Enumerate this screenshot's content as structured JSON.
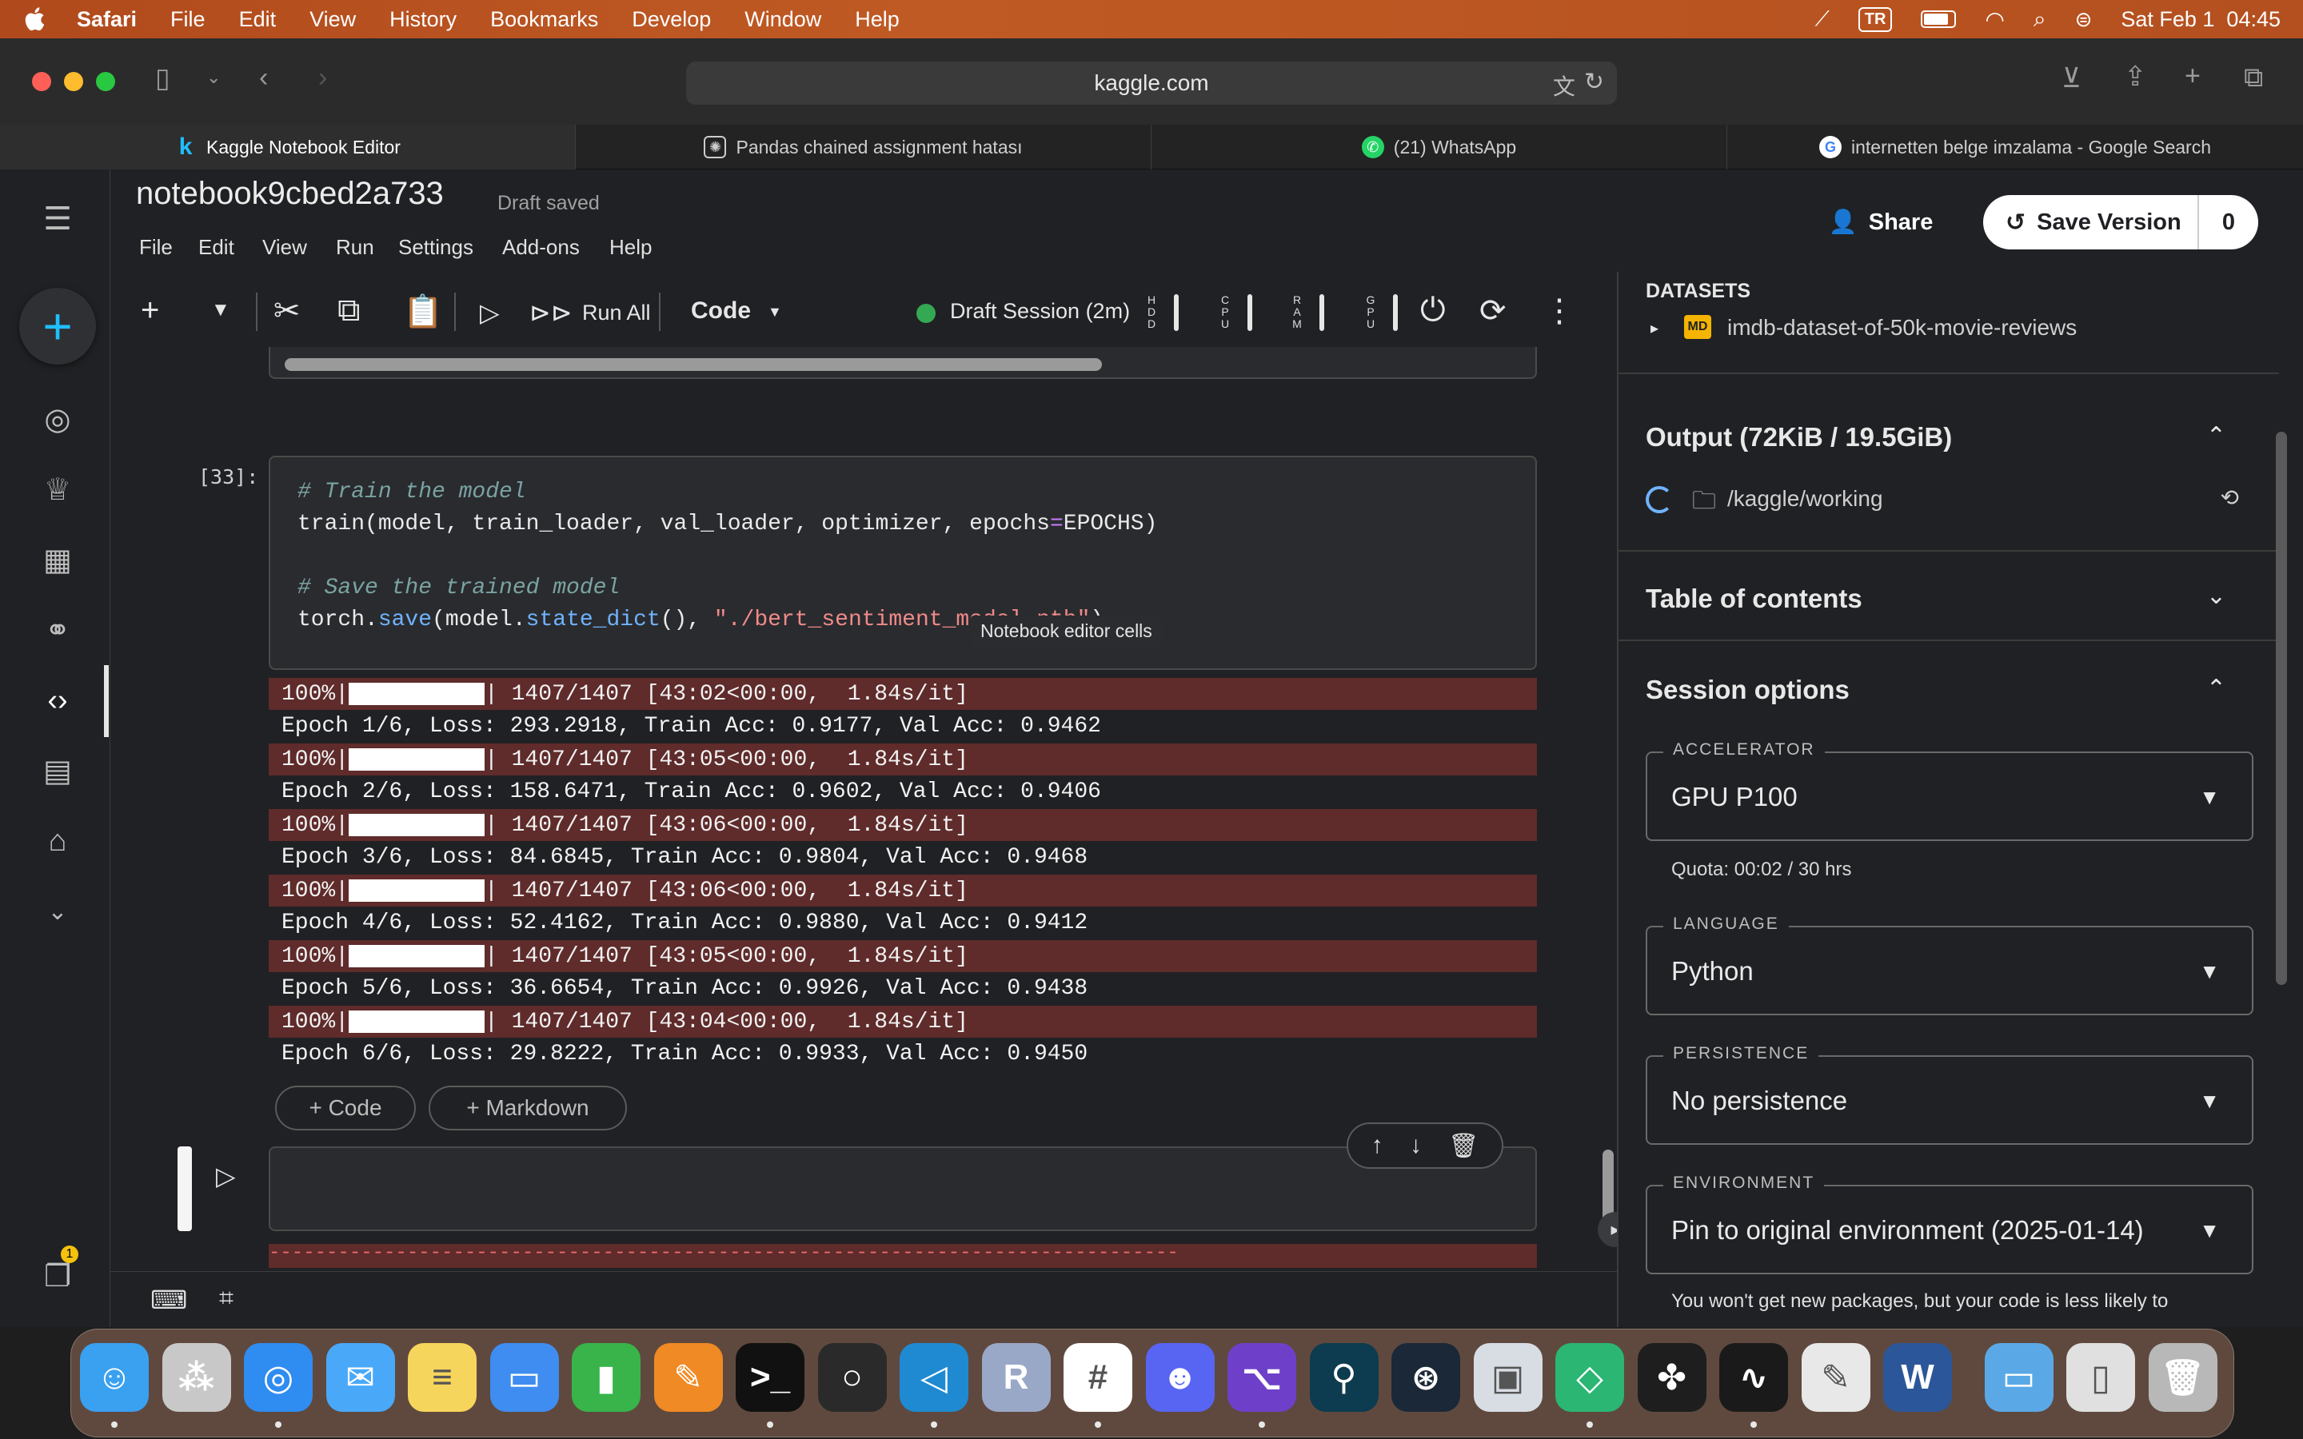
{
  "menubar": {
    "app_name": "Safari",
    "items": [
      "File",
      "Edit",
      "View",
      "History",
      "Bookmarks",
      "Develop",
      "Window",
      "Help"
    ],
    "input_source": "TR",
    "clock": "Sat Feb 1  04:45"
  },
  "browser": {
    "url": "kaggle.com",
    "tabs": [
      {
        "title": "Kaggle Notebook Editor",
        "icon": "kaggle-k",
        "active": true
      },
      {
        "title": "Pandas chained assignment hatası",
        "icon": "openai-logo"
      },
      {
        "title": "(21) WhatsApp",
        "icon": "whatsapp-logo"
      },
      {
        "title": "internetten belge imzalama - Google Search",
        "icon": "google-logo"
      }
    ]
  },
  "notebook": {
    "title": "notebook9cbed2a733",
    "save_status": "Draft saved",
    "menu": [
      "File",
      "Edit",
      "View",
      "Run",
      "Settings",
      "Add-ons",
      "Help"
    ],
    "share_label": "Share",
    "save_version_label": "Save Version",
    "save_version_count": "0"
  },
  "toolbar": {
    "run_all_label": "Run All",
    "cell_type": "Code",
    "session_status": "Draft Session (2m)",
    "session_color": "#34a853",
    "gauges": [
      {
        "label": "H\nD\nD"
      },
      {
        "label": "C\nP\nU"
      },
      {
        "label": "R\nA\nM"
      },
      {
        "label": "G\nP\nU"
      }
    ]
  },
  "cell": {
    "execution_count": "[33]:",
    "code": [
      {
        "parts": [
          {
            "t": "# Train the model",
            "c": "cmt"
          }
        ]
      },
      {
        "parts": [
          {
            "t": "train(model, train_loader, val_loader, optimizer, epochs"
          },
          {
            "t": "=",
            "c": "op"
          },
          {
            "t": "EPOCHS)"
          }
        ]
      },
      {
        "parts": [
          {
            "t": ""
          }
        ]
      },
      {
        "parts": [
          {
            "t": "# Save the trained model",
            "c": "cmt"
          }
        ]
      },
      {
        "parts": [
          {
            "t": "torch."
          },
          {
            "t": "save",
            "c": "fn"
          },
          {
            "t": "(model."
          },
          {
            "t": "state_dict",
            "c": "fn"
          },
          {
            "t": "(), "
          },
          {
            "t": "\"./bert_sentiment_model.pth\"",
            "c": "str"
          },
          {
            "t": ")"
          }
        ]
      }
    ],
    "tooltip": "Notebook editor cells",
    "output": [
      {
        "progress": "100%|",
        "stats": "| 1407/1407 [43:02<00:00,  1.84s/it]",
        "epoch": "Epoch 1/6, Loss: 293.2918, Train Acc: 0.9177, Val Acc: 0.9462"
      },
      {
        "progress": "100%|",
        "stats": "| 1407/1407 [43:05<00:00,  1.84s/it]",
        "epoch": "Epoch 2/6, Loss: 158.6471, Train Acc: 0.9602, Val Acc: 0.9406"
      },
      {
        "progress": "100%|",
        "stats": "| 1407/1407 [43:06<00:00,  1.84s/it]",
        "epoch": "Epoch 3/6, Loss: 84.6845, Train Acc: 0.9804, Val Acc: 0.9468"
      },
      {
        "progress": "100%|",
        "stats": "| 1407/1407 [43:06<00:00,  1.84s/it]",
        "epoch": "Epoch 4/6, Loss: 52.4162, Train Acc: 0.9880, Val Acc: 0.9412"
      },
      {
        "progress": "100%|",
        "stats": "| 1407/1407 [43:05<00:00,  1.84s/it]",
        "epoch": "Epoch 5/6, Loss: 36.6654, Train Acc: 0.9926, Val Acc: 0.9438"
      },
      {
        "progress": "100%|",
        "stats": "| 1407/1407 [43:04<00:00,  1.84s/it]",
        "epoch": "Epoch 6/6, Loss: 29.8222, Train Acc: 0.9933, Val Acc: 0.9450"
      }
    ],
    "add_code_label": "+ Code",
    "add_markdown_label": "+ Markdown"
  },
  "next_cell_output": "-------------------------------------------------------------------------------",
  "right_panel": {
    "datasets_header": "DATASETS",
    "dataset_name": "imdb-dataset-of-50k-movie-reviews",
    "output_title": "Output (72KiB / 19.5GiB)",
    "output_path": "/kaggle/working",
    "toc_title": "Table of contents",
    "session_title": "Session options",
    "accelerator_label": "ACCELERATOR",
    "accelerator_value": "GPU P100",
    "quota": "Quota: 00:02 / 30 hrs",
    "language_label": "LANGUAGE",
    "language_value": "Python",
    "persistence_label": "PERSISTENCE",
    "persistence_value": "No persistence",
    "environment_label": "ENVIRONMENT",
    "environment_value": "Pin to original environment (2025-01-14)",
    "environment_note": "You won't get new packages, but your code is less likely to"
  },
  "left_nav": {
    "notification_count": "1"
  },
  "dock": [
    {
      "name": "finder",
      "color": "#3aa0f0"
    },
    {
      "name": "launchpad",
      "color": "#c8c8c8"
    },
    {
      "name": "safari",
      "color": "#2f8cf0"
    },
    {
      "name": "mail",
      "color": "#4aa8f8"
    },
    {
      "name": "notes",
      "color": "#f6d55c"
    },
    {
      "name": "keynote",
      "color": "#3f8df0"
    },
    {
      "name": "numbers",
      "color": "#38b44a"
    },
    {
      "name": "pages",
      "color": "#f08a24"
    },
    {
      "name": "terminal",
      "color": "#111111"
    },
    {
      "name": "activity-ring",
      "color": "#2a2a2a"
    },
    {
      "name": "vscode",
      "color": "#1f8ad2"
    },
    {
      "name": "r-studio",
      "color": "#9aa8c8"
    },
    {
      "name": "slack",
      "color": "#ffffff"
    },
    {
      "name": "discord",
      "color": "#5865f2"
    },
    {
      "name": "github-desktop",
      "color": "#6e40c9"
    },
    {
      "name": "gitkraken",
      "color": "#0d3b4f"
    },
    {
      "name": "steam",
      "color": "#1b2838"
    },
    {
      "name": "preview",
      "color": "#d8dde4"
    },
    {
      "name": "proton-vpn",
      "color": "#2bb673"
    },
    {
      "name": "figma",
      "color": "#1e1e1e"
    },
    {
      "name": "activity-monitor",
      "color": "#1a1a1a"
    },
    {
      "name": "script-editor",
      "color": "#e8e8e8"
    },
    {
      "name": "word",
      "color": "#2b579a"
    },
    {
      "name": "folder",
      "color": "#5aa9e6"
    },
    {
      "name": "documents",
      "color": "#e0e0e0"
    },
    {
      "name": "trash",
      "color": "#b8b8b8"
    }
  ]
}
